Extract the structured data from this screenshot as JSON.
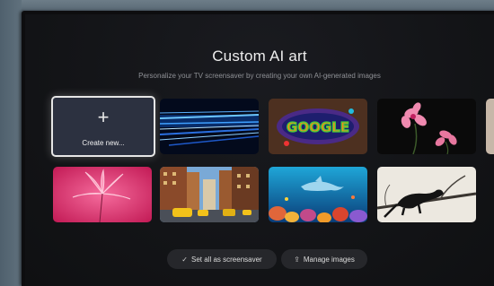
{
  "header": {
    "title": "Custom AI art",
    "subtitle": "Personalize your TV screensaver by creating your own AI-generated images"
  },
  "create_tile": {
    "icon": "plus-icon",
    "label": "Create new..."
  },
  "gallery": [
    {
      "subject": "blue light streaks"
    },
    {
      "subject": "graffiti wall"
    },
    {
      "subject": "pink flowers"
    },
    {
      "subject": "pink lily"
    },
    {
      "subject": "city street with taxis"
    },
    {
      "subject": "underwater dolphin reef"
    },
    {
      "subject": "black panther on branch"
    }
  ],
  "actions": {
    "screensaver_label": "Set all as screensaver",
    "screensaver_icon": "check-icon",
    "manage_label": "Manage images",
    "manage_icon": "upload-icon"
  },
  "colors": {
    "background": "#131417",
    "accent_text": "#ededed",
    "button_bg": "#26272b"
  }
}
